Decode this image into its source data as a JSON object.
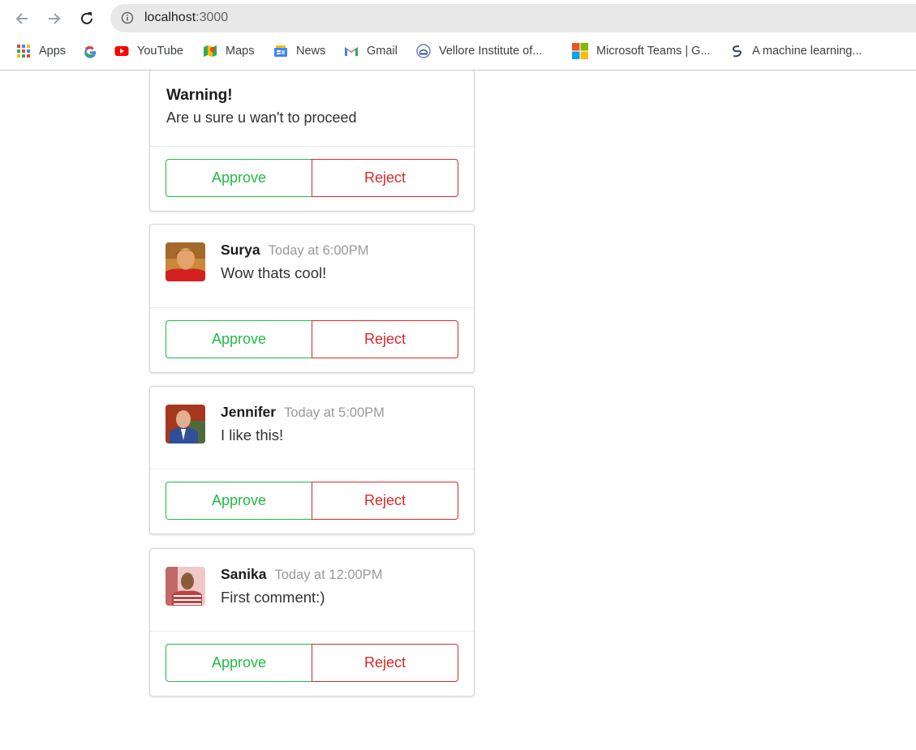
{
  "browser": {
    "url_host": "localhost",
    "url_port": ":3000",
    "bookmarks": [
      {
        "label": "Apps",
        "icon": "apps-grid-icon"
      },
      {
        "label": "",
        "icon": "google-icon"
      },
      {
        "label": "YouTube",
        "icon": "youtube-icon"
      },
      {
        "label": "Maps",
        "icon": "maps-icon"
      },
      {
        "label": "News",
        "icon": "news-icon"
      },
      {
        "label": "Gmail",
        "icon": "gmail-icon"
      },
      {
        "label": "Vellore Institute of...",
        "icon": "vit-logo-icon"
      },
      {
        "label": "Microsoft Teams | G...",
        "icon": "microsoft-icon"
      },
      {
        "label": "A machine learning...",
        "icon": "ml-site-icon"
      }
    ]
  },
  "warning": {
    "title": "Warning!",
    "text": "Are u sure u wan't to proceed",
    "approve_label": "Approve",
    "reject_label": "Reject"
  },
  "comments": [
    {
      "author": "Surya",
      "time": "Today at 6:00PM",
      "text": "Wow thats cool!",
      "approve_label": "Approve",
      "reject_label": "Reject"
    },
    {
      "author": "Jennifer",
      "time": "Today at 5:00PM",
      "text": "I like this!",
      "approve_label": "Approve",
      "reject_label": "Reject"
    },
    {
      "author": "Sanika",
      "time": "Today at 12:00PM",
      "text": "First comment:)",
      "approve_label": "Approve",
      "reject_label": "Reject"
    }
  ],
  "colors": {
    "approve": "#21ba45",
    "reject": "#db2828"
  }
}
